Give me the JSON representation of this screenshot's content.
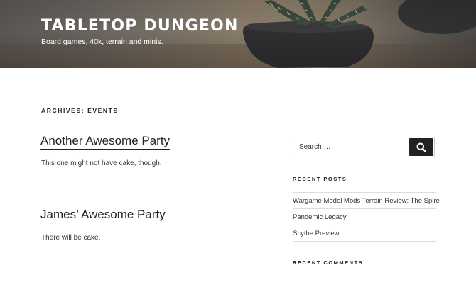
{
  "header": {
    "site_title": "TABLETOP DUNGEON",
    "site_description": "Board games, 40k, terrain and minis."
  },
  "archive": {
    "title": "ARCHIVES: EVENTS"
  },
  "posts": [
    {
      "title": "Another Awesome Party",
      "excerpt": "This one might not have cake, though."
    },
    {
      "title": "James’ Awesome Party",
      "excerpt": "There will be cake."
    }
  ],
  "sidebar": {
    "search": {
      "placeholder": "Search …",
      "value": "",
      "button_icon": "search-icon"
    },
    "recent_posts": {
      "title": "RECENT POSTS",
      "items": [
        "Wargame Model Mods Terrain Review: The Spire",
        "Pandemic Legacy",
        "Scythe Preview"
      ]
    },
    "recent_comments": {
      "title": "RECENT COMMENTS"
    }
  },
  "colors": {
    "text": "#333333",
    "heading": "#222222",
    "button": "#222222",
    "header_text": "#ffffff",
    "divider": "#dddddd"
  }
}
